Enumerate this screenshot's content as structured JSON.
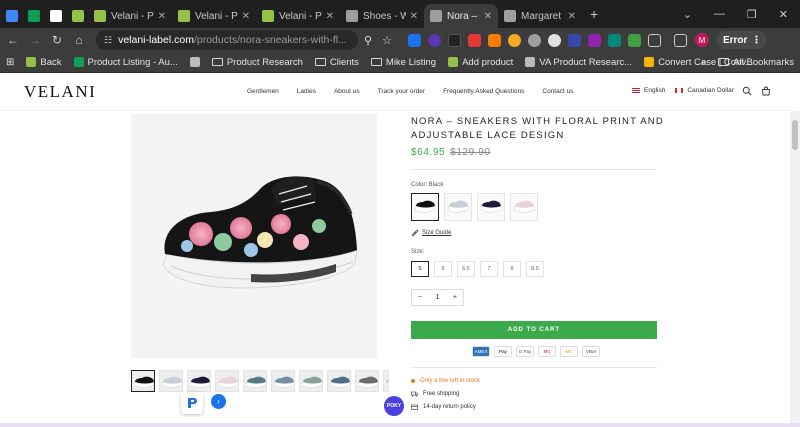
{
  "browser": {
    "tabs": [
      {
        "label": "",
        "icon": "google-docs-icon",
        "color": "#4285f4"
      },
      {
        "label": "",
        "icon": "google-sheets-icon",
        "color": "#0f9d58"
      },
      {
        "label": "",
        "icon": "google-icon",
        "color": "#ffffff"
      },
      {
        "label": "",
        "icon": "shopify-icon",
        "color": "#95bf47"
      },
      {
        "label": "Velani - Prod",
        "icon": "shopify-icon",
        "color": "#95bf47"
      },
      {
        "label": "Velani - Prod",
        "icon": "shopify-icon",
        "color": "#95bf47"
      },
      {
        "label": "Velani - Prod",
        "icon": "shopify-icon",
        "color": "#95bf47"
      },
      {
        "label": "Shoes - Wo",
        "icon": "globe-icon",
        "color": "#9e9e9e"
      },
      {
        "label": "Nora – Snea",
        "icon": "globe-icon",
        "color": "#9e9e9e",
        "active": true
      },
      {
        "label": "Margaret - ",
        "icon": "globe-icon",
        "color": "#9e9e9e"
      }
    ],
    "new_tab": "+",
    "url_host": "velani-label.com",
    "url_path": "/products/nora-sneakers-with-fl...",
    "profile_initial": "M",
    "error_label": "Error",
    "bookmarks": [
      {
        "label": "Back",
        "type": "site",
        "color": "#95bf47"
      },
      {
        "label": "Product Listing - Au...",
        "type": "site",
        "color": "#0f9d58"
      },
      {
        "label": "",
        "type": "site",
        "color": "#bbbbbb"
      },
      {
        "label": "Product Research",
        "type": "folder"
      },
      {
        "label": "Clients",
        "type": "folder"
      },
      {
        "label": "Mike Listing",
        "type": "folder"
      },
      {
        "label": "Add product",
        "type": "site",
        "color": "#95bf47"
      },
      {
        "label": "VA Product Researc...",
        "type": "site",
        "color": "#bbbbbb"
      },
      {
        "label": "Convert Case | Conv...",
        "type": "site",
        "color": "#f4b400"
      }
    ],
    "more_bookmarks": "»",
    "all_bookmarks": "All Bookmarks"
  },
  "site": {
    "logo": "VELANI",
    "nav": [
      "Gentlemen",
      "Ladies",
      "About us",
      "Track your order",
      "Frequently Asked Questions",
      "Contact us"
    ],
    "language": "English",
    "currency": "Canadian Dollar"
  },
  "product": {
    "title": "NORA – SNEAKERS WITH FLORAL PRINT AND ADJUSTABLE LACE DESIGN",
    "price": "$64.95",
    "compare_price": "$129.90",
    "color_label": "Color: Black",
    "swatch_colors": [
      "#111111",
      "#c9cdd8",
      "#1c1c3a",
      "#e8d2dc"
    ],
    "size_guide": "Size Guide",
    "size_label": "Size:",
    "sizes": [
      "5",
      "6",
      "6.5",
      "7",
      "8",
      "8.5"
    ],
    "selected_size": "5",
    "quantity": "1",
    "qty_minus": "−",
    "qty_plus": "+",
    "add_to_cart": "ADD TO CART",
    "payments": [
      "AMEX",
      "Pay",
      "G Pay",
      "MC",
      "MC",
      "VISA"
    ],
    "stock_note": "Only a few left in stock",
    "features": [
      "Free shipping",
      "14-day return policy"
    ]
  },
  "widgets": {
    "poky": "POKY"
  }
}
